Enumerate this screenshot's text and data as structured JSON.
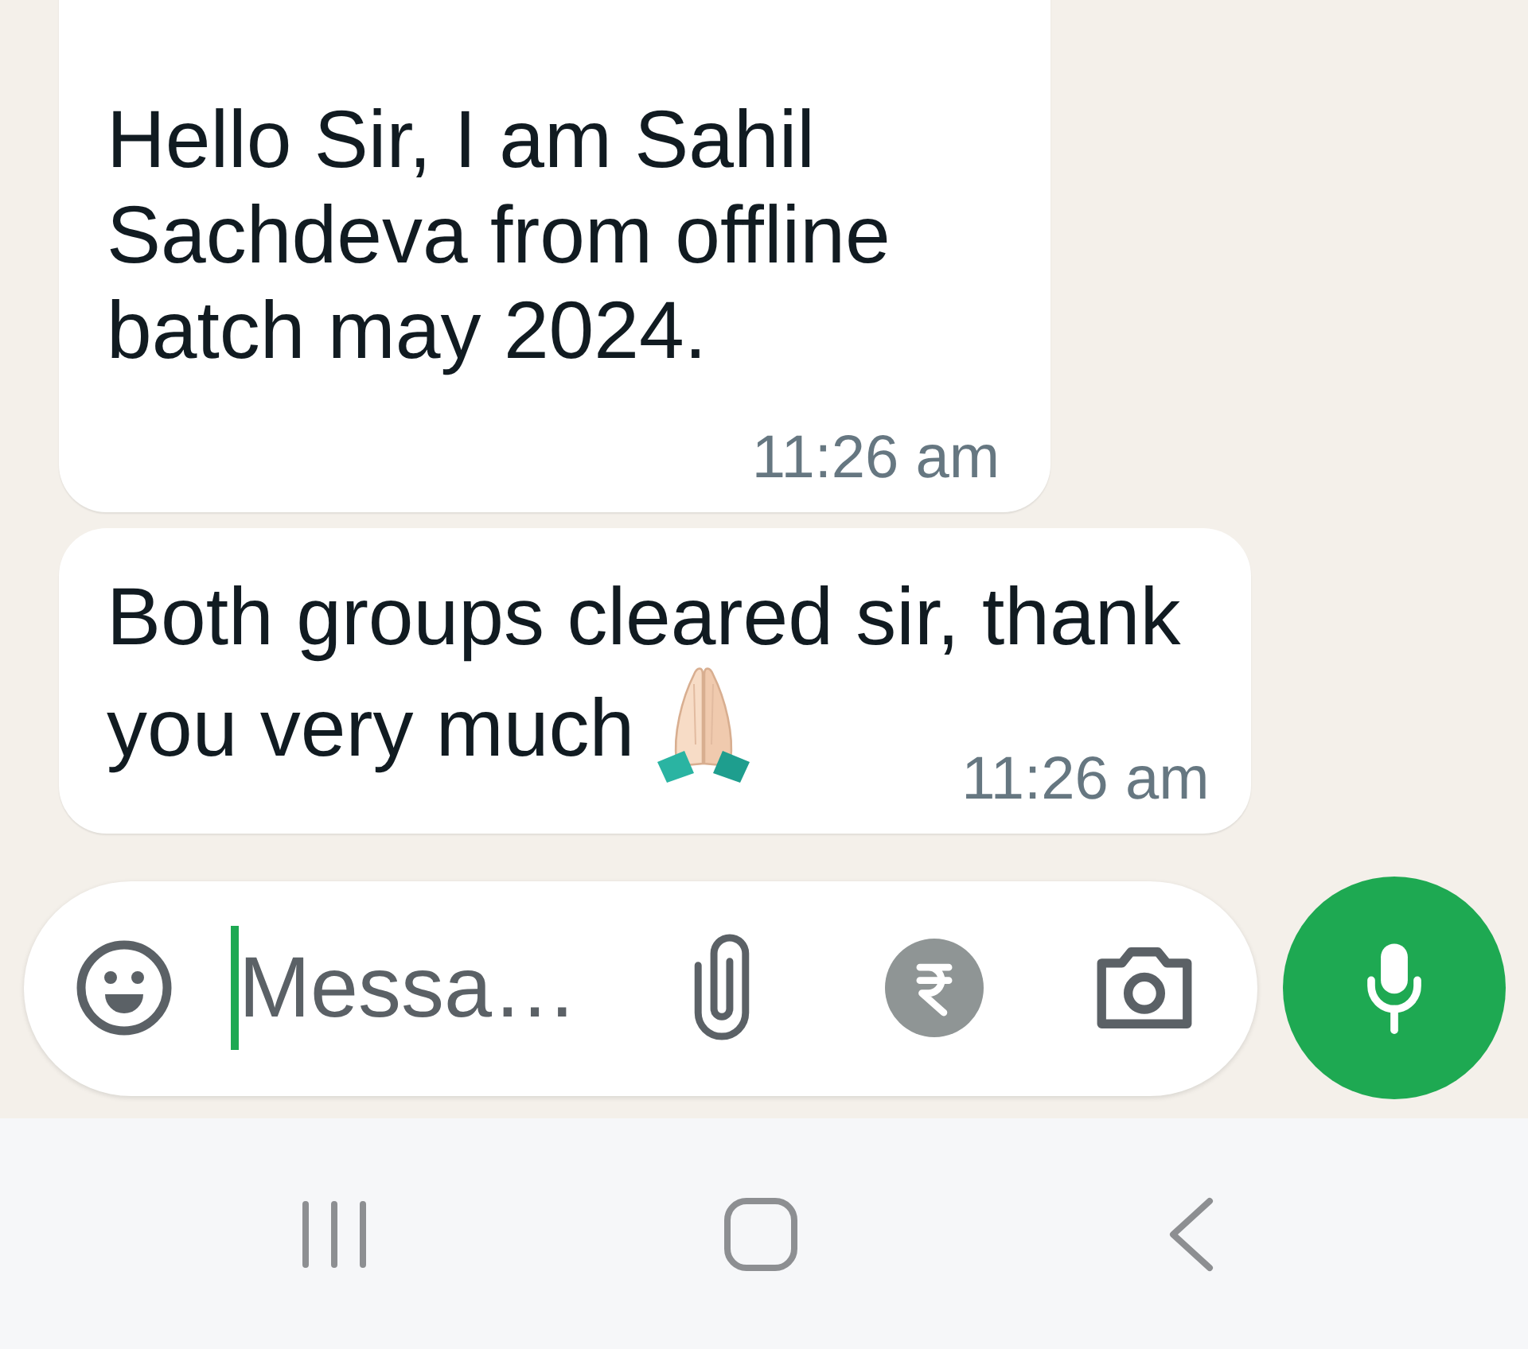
{
  "messages": [
    {
      "kind": "text",
      "lines": [
        "Hello Sir, I am Sahil",
        "Sachdeva from offline",
        "batch may 2024."
      ],
      "time": "11:26 am"
    },
    {
      "kind": "text-emoji",
      "lines": [
        "Both groups cleared sir, thank",
        "you very much"
      ],
      "time": "11:26 am"
    }
  ],
  "composer": {
    "placeholder": "Messa…",
    "focused": true
  }
}
